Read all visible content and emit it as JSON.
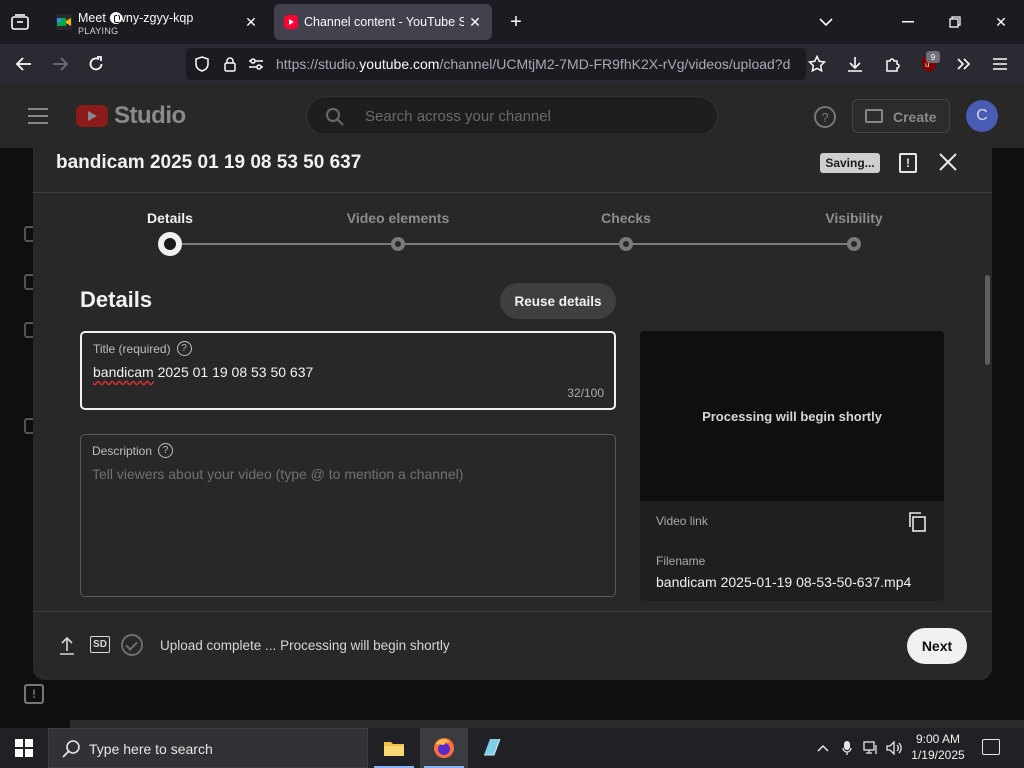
{
  "browser": {
    "tabs": [
      {
        "title": "Meet - wny-zgyy-kqp",
        "subtitle": "PLAYING",
        "active": false
      },
      {
        "title": "Channel content - YouTube Studio",
        "active": true
      }
    ],
    "url_prefix": "https://studio.",
    "url_host": "youtube.com",
    "url_path": "/channel/UCMtjM2-7MD-FR9fhK2X-rVg/videos/upload?d",
    "extension_badge": "9"
  },
  "studio": {
    "brand": "Studio",
    "search_placeholder": "Search across your channel",
    "create_label": "Create",
    "avatar_letter": "C"
  },
  "dialog": {
    "title": "bandicam 2025 01 19 08 53 50 637",
    "saving_label": "Saving...",
    "steps": [
      {
        "label": "Details",
        "active": true
      },
      {
        "label": "Video elements",
        "active": false
      },
      {
        "label": "Checks",
        "active": false
      },
      {
        "label": "Visibility",
        "active": false
      }
    ],
    "section_heading": "Details",
    "reuse_label": "Reuse details",
    "title_field": {
      "label": "Title (required)",
      "value_word1": "bandicam",
      "value_rest": " 2025 01 19 08 53 50 637",
      "counter": "32/100"
    },
    "description_field": {
      "label": "Description",
      "placeholder": "Tell viewers about your video (type @ to mention a channel)"
    },
    "preview": {
      "processing_message": "Processing will begin shortly",
      "video_link_label": "Video link",
      "filename_label": "Filename",
      "filename_value": "bandicam 2025-01-19 08-53-50-637.mp4"
    },
    "footer": {
      "sd_label": "SD",
      "status": "Upload complete ... Processing will begin shortly",
      "next_label": "Next"
    }
  },
  "taskbar": {
    "search_placeholder": "Type here to search",
    "time": "9:00 AM",
    "date": "1/19/2025"
  },
  "colors": {
    "dialog_bg": "#282828",
    "youtube_red": "#ff0033",
    "primary_button": "#f1f1f1"
  }
}
